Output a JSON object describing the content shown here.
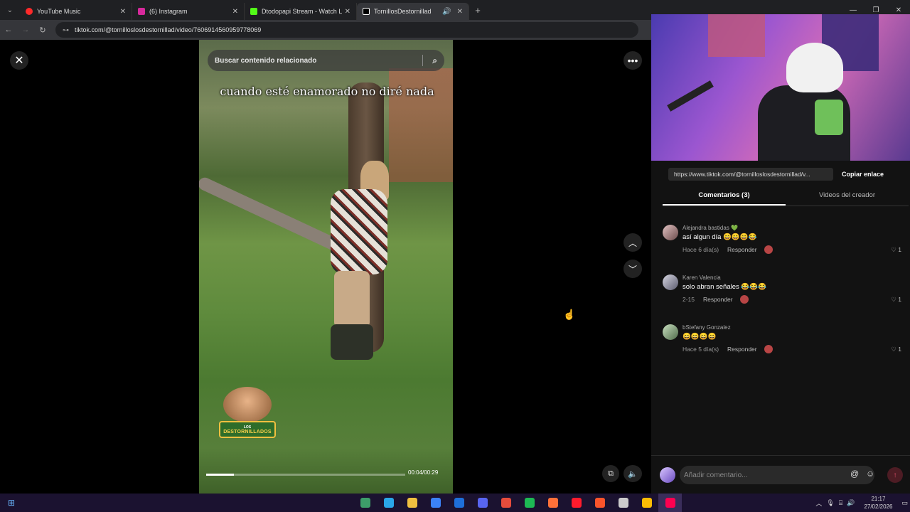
{
  "browser": {
    "tabs": [
      {
        "title": "YouTube Music",
        "fav_color": "#ff2a2a",
        "active": false
      },
      {
        "title": "(6) Instagram",
        "fav_color": "#d6299b",
        "active": false
      },
      {
        "title": "Dtodopapi Stream - Watch Live",
        "fav_color": "#53fc18",
        "active": false
      },
      {
        "title": "TornillosDestornillad",
        "fav_color": "#ffffff",
        "active": true
      }
    ],
    "url": "tiktok.com/@tornilloslosdestornillad/video/7606914560959778069"
  },
  "video": {
    "search_placeholder": "Buscar contenido relacionado",
    "caption": "cuando esté enamorado no diré nada",
    "logo_top": "LOS",
    "logo_bottom": "DESTORNILLADOS",
    "timecode": "00:04/00:29",
    "progress_fraction": 0.14
  },
  "sidebar": {
    "share_url": "https://www.tiktok.com/@tornilloslosdestornillad/v...",
    "copy_label": "Copiar enlace",
    "tabs": [
      "Comentarios (3)",
      "Videos del creador"
    ],
    "comments": [
      {
        "name": "Alejandra bastidas 💚",
        "text": "así algun día 😄😄😄😂",
        "time": "Hace 6 día(s)",
        "reply": "Responder",
        "likes": "♡ 1"
      },
      {
        "name": "Karen Valencia",
        "text": "solo abran señales 😂😂😂",
        "time": "2-15",
        "reply": "Responder",
        "likes": "♡ 1"
      },
      {
        "name": "bStefany Gonzalez",
        "text": "😄😄😄😄",
        "time": "Hace 5 día(s)",
        "reply": "Responder",
        "likes": "♡ 1"
      }
    ],
    "composer_placeholder": "Añadir comentario..."
  },
  "taskbar": {
    "time": "21:17",
    "date": "27/02/2026",
    "app_colors": [
      "#3d9e6a",
      "#2aa7e8",
      "#f0c040",
      "#3b82f6",
      "#1e6fd9",
      "#5865f2",
      "#e74c3c",
      "#1db954",
      "#ff7139",
      "#ff1b2d",
      "#fb542b",
      "#cccccc",
      "#fbbc05",
      "#ff0050"
    ]
  }
}
